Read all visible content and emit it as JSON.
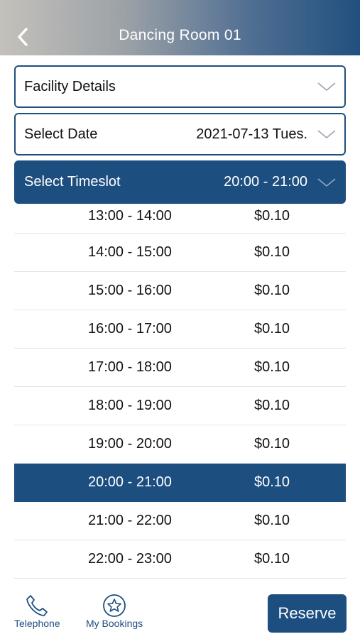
{
  "header": {
    "title": "Dancing Room 01"
  },
  "facility_details": {
    "label": "Facility Details"
  },
  "select_date": {
    "label": "Select Date",
    "value": "2021-07-13 Tues."
  },
  "select_timeslot": {
    "label": "Select Timeslot",
    "value": "20:00 - 21:00"
  },
  "timeslots": [
    {
      "time": "13:00 - 14:00",
      "price": "$0.10"
    },
    {
      "time": "14:00 - 15:00",
      "price": "$0.10"
    },
    {
      "time": "15:00 - 16:00",
      "price": "$0.10"
    },
    {
      "time": "16:00 - 17:00",
      "price": "$0.10"
    },
    {
      "time": "17:00 - 18:00",
      "price": "$0.10"
    },
    {
      "time": "18:00 - 19:00",
      "price": "$0.10"
    },
    {
      "time": "19:00 - 20:00",
      "price": "$0.10"
    },
    {
      "time": "20:00 - 21:00",
      "price": "$0.10"
    },
    {
      "time": "21:00 - 22:00",
      "price": "$0.10"
    },
    {
      "time": "22:00 - 23:00",
      "price": "$0.10"
    }
  ],
  "bottom_bar": {
    "telephone_label": "Telephone",
    "bookings_label": "My Bookings",
    "reserve_label": "Reserve"
  },
  "colors": {
    "primary": "#1d4e80",
    "border": "#1f4f7d"
  },
  "icons": [
    "back-chevron-icon",
    "chevron-down-icon",
    "phone-icon",
    "star-icon"
  ]
}
